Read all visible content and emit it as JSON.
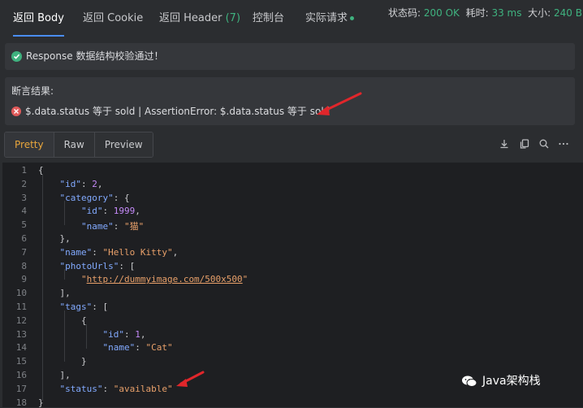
{
  "tabs": [
    {
      "label": "返回 Body",
      "active": true
    },
    {
      "label": "返回 Cookie"
    },
    {
      "label": "返回 Header",
      "count": "(7)"
    },
    {
      "label": "控制台"
    },
    {
      "label": "实际请求"
    }
  ],
  "status": {
    "code_label": "状态码:",
    "code_value": "200 OK",
    "time_label": "耗时:",
    "time_value": "33 ms",
    "size_label": "大小:",
    "size_value": "240 B"
  },
  "validation": {
    "message": "Response 数据结构校验通过！"
  },
  "assertion": {
    "title": "断言结果:",
    "message": "$.data.status 等于 sold | AssertionError: $.data.status 等于 sold"
  },
  "view_modes": [
    {
      "label": "Pretty",
      "active": true
    },
    {
      "label": "Raw"
    },
    {
      "label": "Preview"
    }
  ],
  "toolbar_icons": [
    "download-icon",
    "copy-icon",
    "search-icon",
    "more-icon"
  ],
  "code": {
    "line_numbers": [
      "1",
      "2",
      "3",
      "4",
      "5",
      "6",
      "7",
      "8",
      "9",
      "10",
      "11",
      "12",
      "13",
      "14",
      "15",
      "16",
      "17",
      "18"
    ],
    "lines": [
      [
        {
          "t": "{",
          "c": "p"
        }
      ],
      [
        {
          "t": "    ",
          "c": "p"
        },
        {
          "t": "\"id\"",
          "c": "k"
        },
        {
          "t": ": ",
          "c": "p"
        },
        {
          "t": "2",
          "c": "n"
        },
        {
          "t": ",",
          "c": "p"
        }
      ],
      [
        {
          "t": "    ",
          "c": "p"
        },
        {
          "t": "\"category\"",
          "c": "k"
        },
        {
          "t": ": {",
          "c": "p"
        }
      ],
      [
        {
          "t": "        ",
          "c": "p"
        },
        {
          "t": "\"id\"",
          "c": "k"
        },
        {
          "t": ": ",
          "c": "p"
        },
        {
          "t": "1999",
          "c": "n"
        },
        {
          "t": ",",
          "c": "p"
        }
      ],
      [
        {
          "t": "        ",
          "c": "p"
        },
        {
          "t": "\"name\"",
          "c": "k"
        },
        {
          "t": ": ",
          "c": "p"
        },
        {
          "t": "\"猫\"",
          "c": "s"
        }
      ],
      [
        {
          "t": "    },",
          "c": "p"
        }
      ],
      [
        {
          "t": "    ",
          "c": "p"
        },
        {
          "t": "\"name\"",
          "c": "k"
        },
        {
          "t": ": ",
          "c": "p"
        },
        {
          "t": "\"Hello Kitty\"",
          "c": "s"
        },
        {
          "t": ",",
          "c": "p"
        }
      ],
      [
        {
          "t": "    ",
          "c": "p"
        },
        {
          "t": "\"photoUrls\"",
          "c": "k"
        },
        {
          "t": ": [",
          "c": "p"
        }
      ],
      [
        {
          "t": "        ",
          "c": "p"
        },
        {
          "t": "\"",
          "c": "s"
        },
        {
          "t": "http://dummyimage.com/500x500",
          "c": "link"
        },
        {
          "t": "\"",
          "c": "s"
        }
      ],
      [
        {
          "t": "    ],",
          "c": "p"
        }
      ],
      [
        {
          "t": "    ",
          "c": "p"
        },
        {
          "t": "\"tags\"",
          "c": "k"
        },
        {
          "t": ": [",
          "c": "p"
        }
      ],
      [
        {
          "t": "        {",
          "c": "p"
        }
      ],
      [
        {
          "t": "            ",
          "c": "p"
        },
        {
          "t": "\"id\"",
          "c": "k"
        },
        {
          "t": ": ",
          "c": "p"
        },
        {
          "t": "1",
          "c": "n"
        },
        {
          "t": ",",
          "c": "p"
        }
      ],
      [
        {
          "t": "            ",
          "c": "p"
        },
        {
          "t": "\"name\"",
          "c": "k"
        },
        {
          "t": ": ",
          "c": "p"
        },
        {
          "t": "\"Cat\"",
          "c": "s"
        }
      ],
      [
        {
          "t": "        }",
          "c": "p"
        }
      ],
      [
        {
          "t": "    ],",
          "c": "p"
        }
      ],
      [
        {
          "t": "    ",
          "c": "p"
        },
        {
          "t": "\"status\"",
          "c": "k"
        },
        {
          "t": ": ",
          "c": "p"
        },
        {
          "t": "\"available\"",
          "c": "s"
        }
      ],
      [
        {
          "t": "}",
          "c": "p"
        }
      ]
    ]
  },
  "watermark": "Java架构栈",
  "colors": {
    "background": "#2b2d30",
    "editor_bg": "#1e1f22",
    "accent_tab": "#4a8df6",
    "success": "#3fb27f",
    "error": "#e05a5a",
    "active_mode": "#e8a63c",
    "arrow": "#e0262b"
  }
}
